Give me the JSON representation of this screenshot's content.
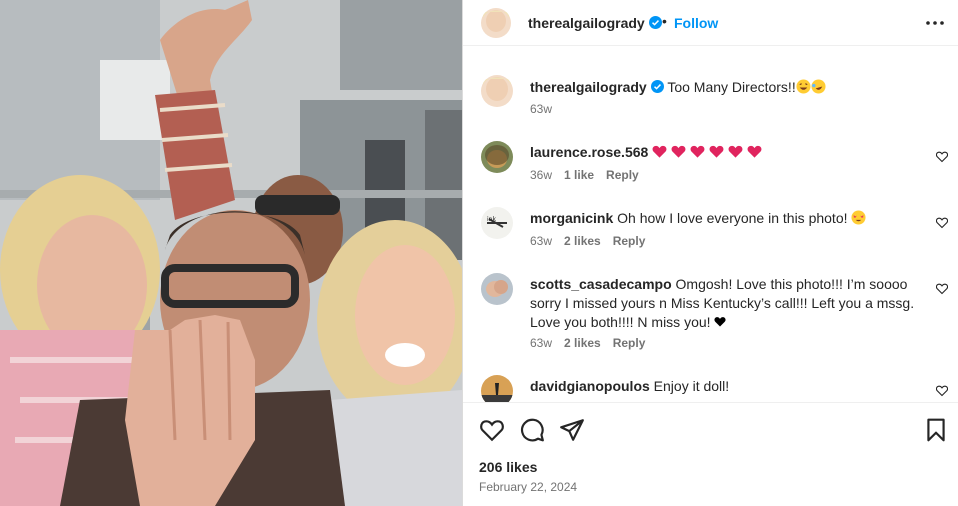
{
  "post": {
    "author": "therealgailogrady",
    "follow_label": "Follow",
    "dot": "•",
    "caption_text": "Too Many Directors!!",
    "caption_time": "63w"
  },
  "comments": [
    {
      "user": "laurence.rose.568",
      "text": "",
      "time": "36w",
      "likes": "1 like",
      "reply": "Reply"
    },
    {
      "user": "morganicink",
      "text": "Oh how I love everyone in this photo!",
      "time": "63w",
      "likes": "2 likes",
      "reply": "Reply"
    },
    {
      "user": "scotts_casadecampo",
      "text": "Omgosh! Love this photo!!! I’m soooo sorry I missed yours n Miss Kentucky’s call!!! Left you a mssg. Love you both!!!! N miss you!",
      "time": "63w",
      "likes": "2 likes",
      "reply": "Reply"
    },
    {
      "user": "davidgianopoulos",
      "text": "Enjoy it doll!"
    }
  ],
  "footer": {
    "likes": "206 likes",
    "date": "February 22, 2024"
  },
  "colors": {
    "follow": "#0095f6",
    "verified": "#0095f6",
    "heart_emoji": "#e0245e",
    "meta_gray": "#737373"
  },
  "icons": {
    "header": [
      "avatar",
      "verified-icon",
      "more-options-icon"
    ],
    "actions": [
      "heart-icon",
      "comment-icon",
      "share-icon",
      "bookmark-icon"
    ],
    "emoji": [
      "laughing-emoji",
      "rolling-laughing-emoji",
      "red-heart-emoji",
      "star-struck-emoji",
      "black-heart-emoji"
    ]
  }
}
